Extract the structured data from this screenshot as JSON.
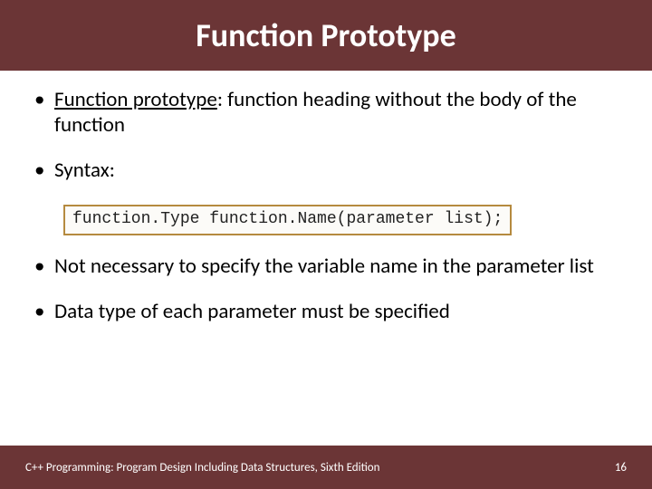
{
  "title": "Function Prototype",
  "bullets": {
    "b1_term": "Function prototype",
    "b1_rest": ": function heading without the body of the function",
    "b2": "Syntax:",
    "b3": "Not necessary to specify the variable name in the parameter list",
    "b4": "Data type of each parameter must be specified"
  },
  "code": "function.Type function.Name(parameter list);",
  "footer": {
    "left": "C++ Programming: Program Design Including Data Structures, Sixth Edition",
    "right": "16"
  }
}
